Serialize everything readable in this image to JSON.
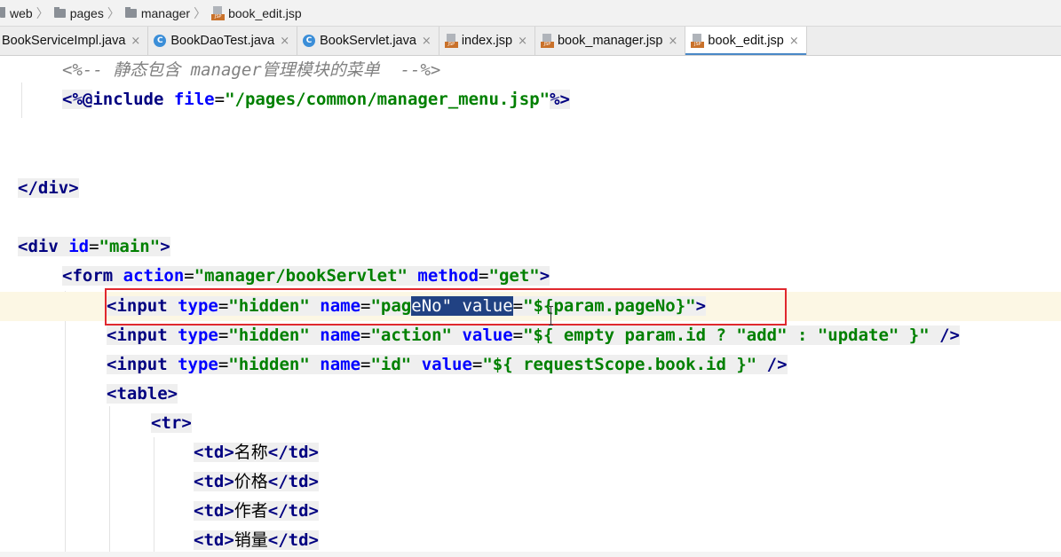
{
  "breadcrumb": {
    "items": [
      "web",
      "pages",
      "manager"
    ],
    "file": "book_edit.jsp"
  },
  "tabs": [
    {
      "label": "BookServiceImpl.java",
      "icon": "java-class-icon"
    },
    {
      "label": "BookDaoTest.java",
      "icon": "java-class-icon"
    },
    {
      "label": "BookServlet.java",
      "icon": "java-class-icon"
    },
    {
      "label": "index.jsp",
      "icon": "jsp-file-icon"
    },
    {
      "label": "book_manager.jsp",
      "icon": "jsp-file-icon"
    },
    {
      "label": "book_edit.jsp",
      "icon": "jsp-file-icon",
      "active": true
    }
  ],
  "close_glyph": "×",
  "jsp_badge": "JSP",
  "class_badge": "C",
  "code": {
    "comment": "<%-- 静态包含 manager管理模块的菜单  --%>",
    "include_open": "<%@",
    "include_kw": "include ",
    "include_attr": "file",
    "include_eq": "=",
    "include_val": "\"/pages/common/manager_menu.jsp\"",
    "include_close": "%>",
    "div_close": "</div>",
    "div_open": "<div ",
    "div_attr": "id",
    "div_val": "\"main\"",
    "div_end": ">",
    "form_open": "<form ",
    "form_attr1": "action",
    "form_val1": "\"manager/bookServlet\"",
    "form_attr2": "method",
    "form_val2": "\"get\"",
    "form_end": ">",
    "input_open": "<input ",
    "attr_type": "type",
    "val_hidden": "\"hidden\"",
    "attr_name": "name",
    "attr_value": "value",
    "eq": "=",
    "l1_name_a": "\"pag",
    "l1_name_b": "eNo\"",
    "l1_sel_space": " ",
    "l1_val": "\"${param.pageNo}\"",
    "l1_end": ">",
    "l2_name": "\"action\"",
    "l2_val": "\"${ empty param.id ? \"add\" : \"update\" }\"",
    "l3_name": "\"id\"",
    "l3_val": "\"${ requestScope.book.id }\"",
    "self_close": " />",
    "table": "<table>",
    "tr": "<tr>",
    "td_open": "<td>",
    "td_close": "</td>",
    "cells": [
      "名称",
      "价格",
      "作者",
      "销量"
    ]
  },
  "colors": {
    "tag": "#000080",
    "attribute": "#0000ff",
    "string": "#008000",
    "comment": "#808080",
    "selection": "#214283",
    "highlight_box": "#e0282e",
    "current_line": "#fcf7e4"
  }
}
